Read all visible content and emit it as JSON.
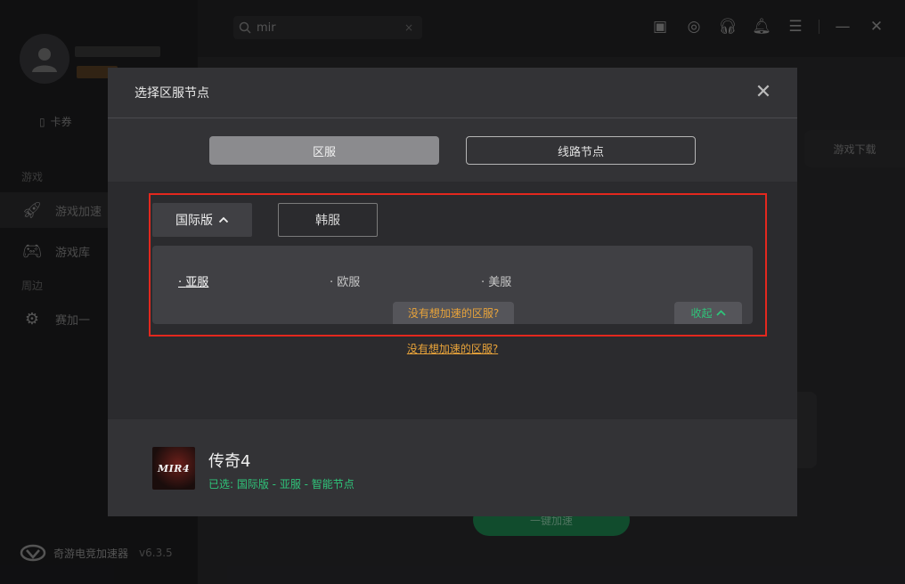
{
  "app": {
    "brand_name": "奇游电竞加速器",
    "version": "v6.3.5"
  },
  "search": {
    "value": "mir",
    "clear_icon": "close-icon"
  },
  "sidebar": {
    "card_label": "卡券",
    "section_games": "游戏",
    "items": [
      {
        "label": "游戏加速",
        "icon": "rocket-icon"
      },
      {
        "label": "游戏库",
        "icon": "gamepad-icon"
      }
    ],
    "section_nearby": "周边",
    "extra_label": "赛加一"
  },
  "background": {
    "download_label": "游戏下载",
    "accelerate_label": "一键加速"
  },
  "modal": {
    "title": "选择区服节点",
    "segments": [
      "区服",
      "线路节点"
    ],
    "version_tabs": [
      "国际版",
      "韩服"
    ],
    "regions": [
      "亚服",
      "欧服",
      "美服"
    ],
    "selected_region": "亚服",
    "no_region_pill": "没有想加速的区服?",
    "collapse_label": "收起",
    "no_region_link": "没有想加速的区服?",
    "game": {
      "name": "传奇4",
      "thumb_text": "MIR4",
      "selection": "已选: 国际版 - 亚服 - 智能节点"
    }
  },
  "colors": {
    "accent_green": "#2fc47a",
    "link_orange": "#e8a33a",
    "highlight_red": "#e3281e"
  }
}
